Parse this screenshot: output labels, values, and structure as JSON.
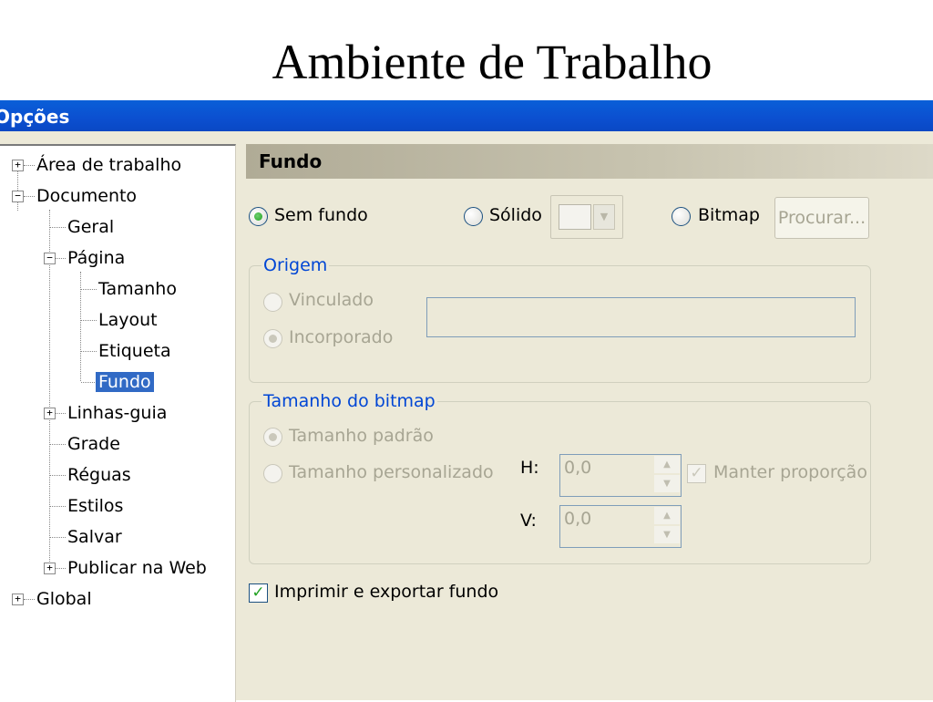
{
  "slide": {
    "title": "Ambiente de Trabalho"
  },
  "window": {
    "title": "Opções"
  },
  "tree": {
    "items": [
      {
        "label": "Área de trabalho"
      },
      {
        "label": "Documento"
      },
      {
        "label": "Geral"
      },
      {
        "label": "Página"
      },
      {
        "label": "Tamanho"
      },
      {
        "label": "Layout"
      },
      {
        "label": "Etiqueta"
      },
      {
        "label": "Fundo"
      },
      {
        "label": "Linhas-guia"
      },
      {
        "label": "Grade"
      },
      {
        "label": "Réguas"
      },
      {
        "label": "Estilos"
      },
      {
        "label": "Salvar"
      },
      {
        "label": "Publicar na Web"
      },
      {
        "label": "Global"
      }
    ]
  },
  "panel": {
    "header": "Fundo",
    "background_options": {
      "none": "Sem fundo",
      "solid": "Sólido",
      "bitmap": "Bitmap",
      "browse_button": "Procurar..."
    },
    "origin": {
      "title": "Origem",
      "linked": "Vinculado",
      "embedded": "Incorporado",
      "path_value": ""
    },
    "bitmap_size": {
      "title": "Tamanho do bitmap",
      "default": "Tamanho padrão",
      "custom": "Tamanho personalizado",
      "h_label": "H:",
      "h_value": "0,0",
      "v_label": "V:",
      "v_value": "0,0",
      "keep_ratio": "Manter proporção"
    },
    "print_export": "Imprimir e exportar fundo"
  },
  "colors": {
    "title_bar": "#0b4fd0",
    "selection": "#316ac5",
    "dialog_bg": "#ece9d8",
    "group_title": "#0046d5",
    "check_green": "#21a121"
  }
}
